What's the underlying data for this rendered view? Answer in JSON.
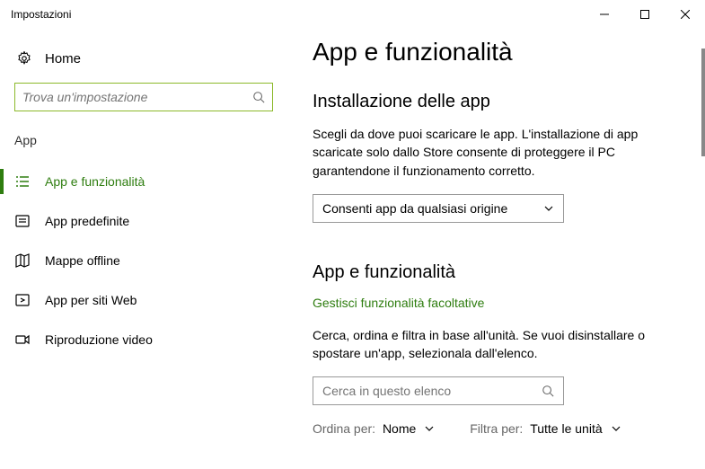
{
  "window": {
    "title": "Impostazioni"
  },
  "sidebar": {
    "home": "Home",
    "search_placeholder": "Trova un'impostazione",
    "section": "App",
    "items": [
      {
        "label": "App e funzionalità"
      },
      {
        "label": "App predefinite"
      },
      {
        "label": "Mappe offline"
      },
      {
        "label": "App per siti Web"
      },
      {
        "label": "Riproduzione video"
      }
    ]
  },
  "main": {
    "title": "App e funzionalità",
    "install_section_title": "Installazione delle app",
    "install_desc": "Scegli da dove puoi scaricare le app. L'installazione di app scaricate solo dallo Store consente di proteggere il PC garantendone il funzionamento corretto.",
    "install_dropdown": "Consenti app da qualsiasi origine",
    "apps_section_title": "App e funzionalità",
    "manage_link": "Gestisci funzionalità facoltative",
    "apps_desc": "Cerca, ordina e filtra in base all'unità. Se vuoi disinstallare o spostare un'app, selezionala dall'elenco.",
    "list_search_placeholder": "Cerca in questo elenco",
    "sort_label": "Ordina per:",
    "sort_value": "Nome",
    "filter_label": "Filtra per:",
    "filter_value": "Tutte le unità"
  }
}
